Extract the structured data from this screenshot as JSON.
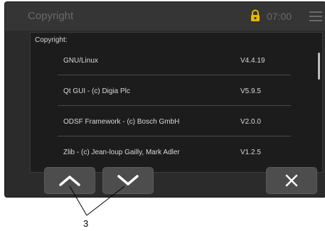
{
  "header": {
    "title": "Copyright",
    "time": "07:00",
    "lock_icon": "lock-icon",
    "lock_color": "#e8b800",
    "menu_icon": "hamburger-menu-icon"
  },
  "panel": {
    "section_title": "Copyright:",
    "items": [
      {
        "name": "GNU/Linux",
        "version": "V4.4.19"
      },
      {
        "name": "Qt GUI - (c) Digia Plc",
        "version": "V5.9.5"
      },
      {
        "name": "ODSF Framework - (c) Bosch GmbH",
        "version": "V2.0.0"
      },
      {
        "name": "Zlib - (c) Jean-loup Gailly, Mark Adler",
        "version": "V1.2.5"
      }
    ]
  },
  "buttons": {
    "up_icon": "chevron-up-icon",
    "down_icon": "chevron-down-icon",
    "close_icon": "close-icon"
  },
  "callout": {
    "label": "3"
  }
}
